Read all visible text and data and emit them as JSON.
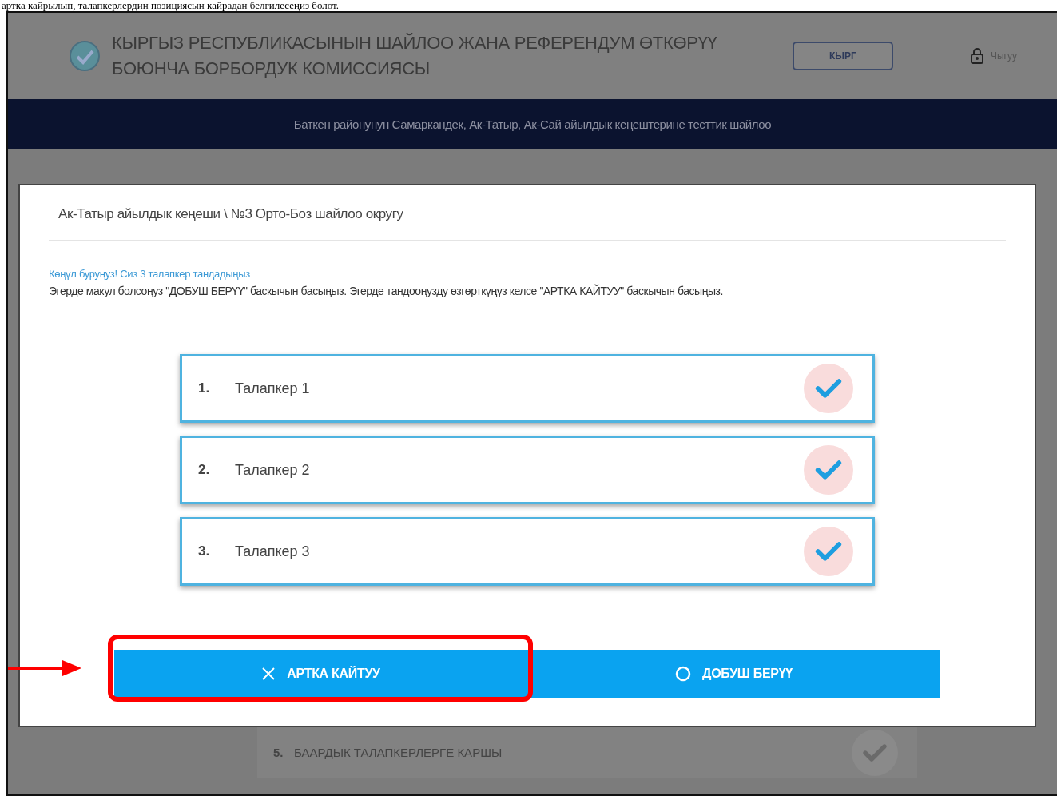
{
  "document_text": "артка кайрылып, талапкерлердин позициясын кайрадан белгилесеңиз болот.",
  "header": {
    "title_lines": [
      "КЫРГЫЗ РЕСПУБЛИКАСЫНЫН ШАЙЛОО ЖАНА РЕФЕРЕНДУМ ӨТКӨРҮҮ",
      "БОЮНЧА БОРБОРДУК КОМИССИЯСЫ"
    ],
    "language_button": "КЫРГ",
    "logout": "Чыгуу"
  },
  "banner": "Баткен районунун Самаркандек, Ак-Татыр, Ак-Сай айылдык кеңештерине тесттик шайлоо",
  "modal": {
    "breadcrumb": "Ак-Татыр айылдык кеңеши \\ №3 Орто-Боз шайлоо округу",
    "notice": "Көңүл буруңуз! Сиз 3 талапкер тандадыңыз",
    "instruction": "Эгерде макул болсоңуз \"ДОБУШ БЕРҮҮ\" баскычын басыңыз. Эгерде тандооңузду өзгөрткүңүз келсе \"АРТКА КАЙТУУ\" баскычын басыңыз.",
    "candidates": [
      {
        "number": "1.",
        "name": "Талапкер 1",
        "selected": true
      },
      {
        "number": "2.",
        "name": "Талапкер 2",
        "selected": true
      },
      {
        "number": "3.",
        "name": "Талапкер 3",
        "selected": true
      }
    ],
    "buttons": [
      {
        "kind": "back",
        "label": "АРТКА КАЙТУУ"
      },
      {
        "kind": "vote",
        "label": "ДОБУШ БЕРҮҮ"
      }
    ]
  },
  "background_item": {
    "number": "5.",
    "name": "БААРДЫК ТАЛАПКЕРЛЕРГЕ КАРШЫ",
    "selected": false
  }
}
